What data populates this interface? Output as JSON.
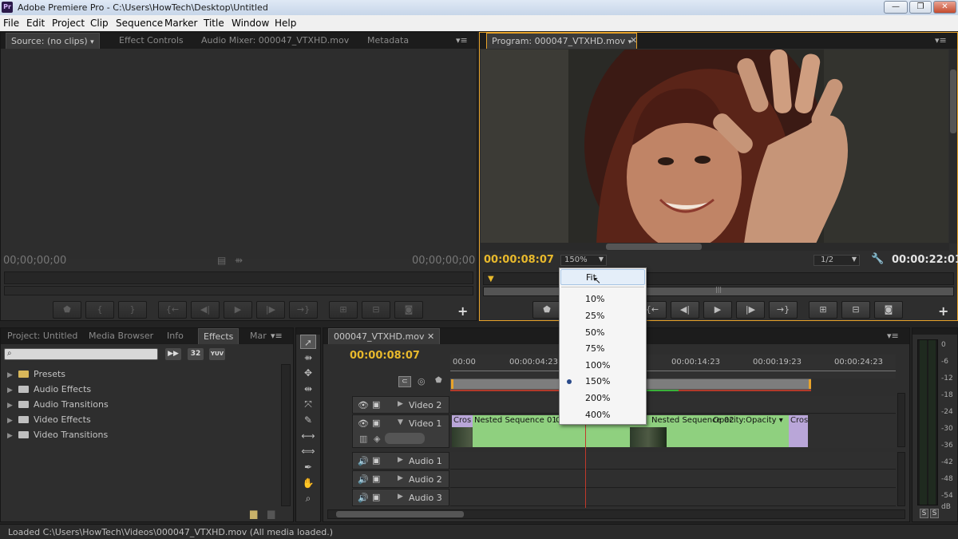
{
  "window": {
    "app_icon_text": "Pr",
    "title": "Adobe Premiere Pro - C:\\Users\\HowTech\\Desktop\\Untitled",
    "minimize": "—",
    "maximize": "❐",
    "close": "✕"
  },
  "menu": [
    "File",
    "Edit",
    "Project",
    "Clip",
    "Sequence",
    "Marker",
    "Title",
    "Window",
    "Help"
  ],
  "source_panel": {
    "tabs": [
      "Source: (no clips)",
      "Effect Controls",
      "Audio Mixer: 000047_VTXHD.mov",
      "Metadata"
    ],
    "timecode_in": "00;00;00;00",
    "timecode_out": "00;00;00;00"
  },
  "program_panel": {
    "tab": "Program: 000047_VTXHD.mov",
    "timecode_current": "00:00:08:07",
    "zoom": "150%",
    "resolution": "1/2",
    "timecode_duration": "00:00:22:01"
  },
  "zoom_menu": {
    "items": [
      "Fit",
      "10%",
      "25%",
      "50%",
      "75%",
      "100%",
      "150%",
      "200%",
      "400%"
    ],
    "selected": "150%",
    "hovered": "Fit"
  },
  "project_panel": {
    "tabs": [
      "Project: Untitled",
      "Media Browser",
      "Info",
      "Effects",
      "Mar"
    ],
    "search_placeholder": "",
    "filter_badges": [
      "32",
      "YUV"
    ],
    "tree": [
      "Presets",
      "Audio Effects",
      "Audio Transitions",
      "Video Effects",
      "Video Transitions"
    ]
  },
  "timeline": {
    "tab": "000047_VTXHD.mov",
    "timecode": "00:00:08:07",
    "ruler": [
      "00:00",
      "00:00:04:23",
      "00:00:14:23",
      "00:00:19:23",
      "00:00:24:23"
    ],
    "video_tracks": [
      "Video 2",
      "Video 1"
    ],
    "audio_tracks": [
      "Audio 1",
      "Audio 2",
      "Audio 3"
    ],
    "clips": {
      "trans1": "Cros",
      "clip1": "Nested Sequence 01",
      "clip1_suffix": "O",
      "clip2": "Nested Sequence 02",
      "clip2_opacity": "Opacity:Opacity ▾",
      "trans2": "Cros"
    }
  },
  "meter": {
    "labels": [
      "0",
      "-6",
      "-12",
      "-18",
      "-24",
      "-30",
      "-36",
      "-42",
      "-48",
      "-54",
      "dB"
    ],
    "solo": [
      "S",
      "S"
    ]
  },
  "status": "Loaded C:\\Users\\HowTech\\Videos\\000047_VTXHD.mov (All media loaded.)",
  "colors": {
    "timecode": "#e8b92c",
    "clip": "#8fd07f",
    "highlight": "#e8a32a"
  }
}
